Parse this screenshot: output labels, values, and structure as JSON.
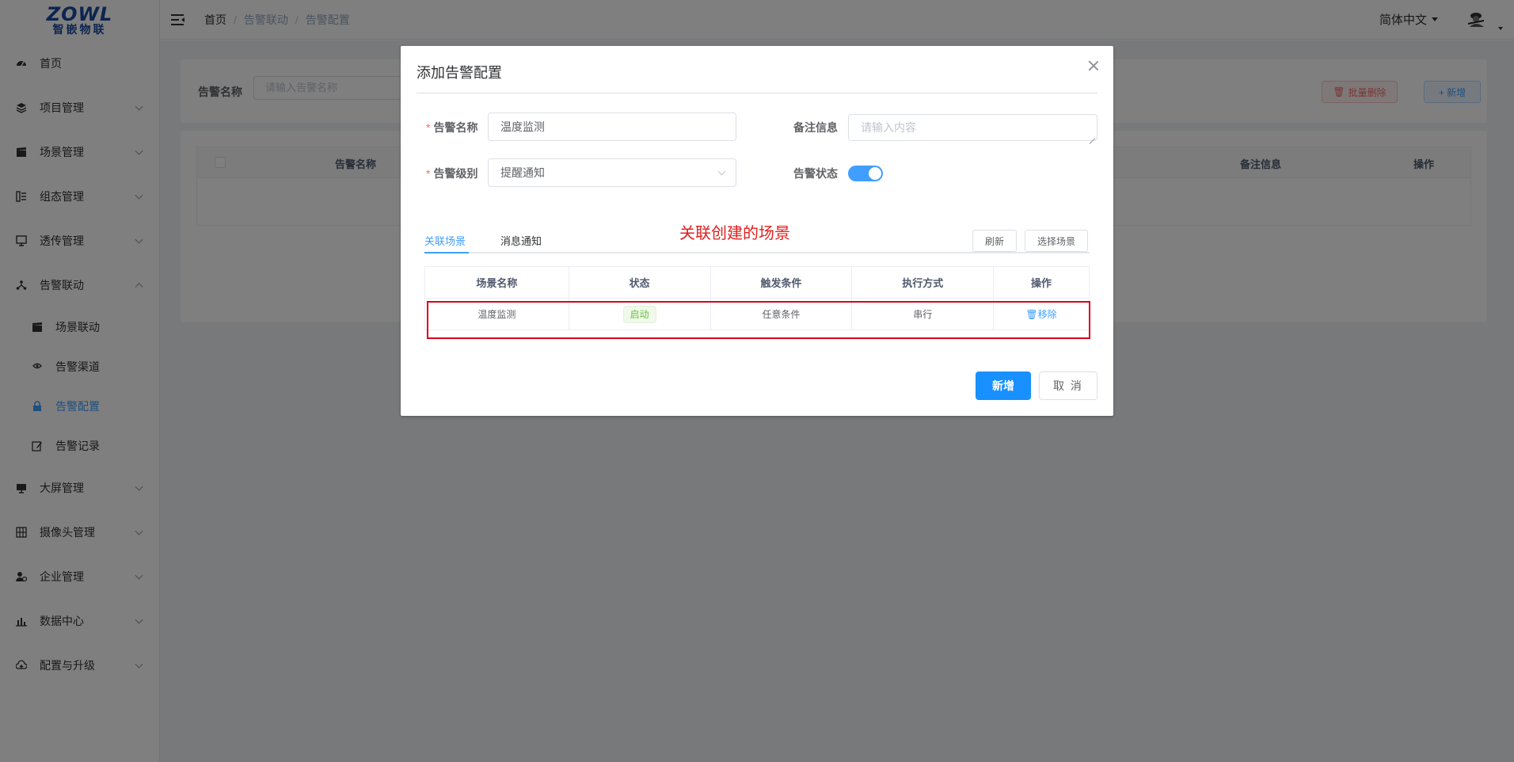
{
  "logo": {
    "brand": "ZOWL",
    "sub": "智嵌物联"
  },
  "sidebar": {
    "items": [
      {
        "label": "首页",
        "icon": "dashboard-icon",
        "expandable": false
      },
      {
        "label": "项目管理",
        "icon": "layers-icon",
        "expandable": true
      },
      {
        "label": "场景管理",
        "icon": "clapperboard-icon",
        "expandable": true
      },
      {
        "label": "组态管理",
        "icon": "list-icon",
        "expandable": true
      },
      {
        "label": "透传管理",
        "icon": "monitor-icon",
        "expandable": true
      },
      {
        "label": "告警联动",
        "icon": "network-icon",
        "expandable": true,
        "expanded": true
      }
    ],
    "subitems": [
      {
        "label": "场景联动",
        "icon": "clapperboard-icon"
      },
      {
        "label": "告警渠道",
        "icon": "channel-icon"
      },
      {
        "label": "告警配置",
        "icon": "lock-icon",
        "active": true
      },
      {
        "label": "告警记录",
        "icon": "edit-icon"
      }
    ],
    "items_after": [
      {
        "label": "大屏管理",
        "icon": "screen-icon"
      },
      {
        "label": "摄像头管理",
        "icon": "grid-icon"
      },
      {
        "label": "企业管理",
        "icon": "user-gear-icon"
      },
      {
        "label": "数据中心",
        "icon": "bar-chart-icon"
      },
      {
        "label": "配置与升级",
        "icon": "cloud-upload-icon"
      }
    ]
  },
  "header": {
    "breadcrumb": [
      "首页",
      "告警联动",
      "告警配置"
    ],
    "language": "简体中文"
  },
  "page": {
    "search_label": "告警名称",
    "search_placeholder": "请输入告警名称",
    "batch_delete": "批量删除",
    "add_button": "+ 新增",
    "table_headers": {
      "name": "告警名称",
      "remark": "备注信息",
      "action": "操作"
    }
  },
  "dialog": {
    "title": "添加告警配置",
    "fields": {
      "name_label": "告警名称",
      "name_value": "温度监测",
      "remark_label": "备注信息",
      "remark_placeholder": "请输入内容",
      "level_label": "告警级别",
      "level_value": "提醒通知",
      "status_label": "告警状态",
      "status_on": true
    },
    "annotation": "关联创建的场景",
    "tabs": [
      {
        "label": "关联场景",
        "active": true
      },
      {
        "label": "消息通知",
        "active": false
      }
    ],
    "refresh_button": "刷新",
    "select_scene_button": "选择场景",
    "table": {
      "headers": [
        "场景名称",
        "状态",
        "触发条件",
        "执行方式",
        "操作"
      ],
      "rows": [
        {
          "name": "温度监测",
          "status": "启动",
          "trigger": "任意条件",
          "mode": "串行",
          "action": "移除"
        }
      ]
    },
    "confirm_button": "新增",
    "cancel_button": "取 消"
  },
  "colors": {
    "primary": "#1890ff",
    "accent": "#409eff",
    "danger": "#f56c6c",
    "success": "#67c23a",
    "annotation": "#e02020"
  }
}
